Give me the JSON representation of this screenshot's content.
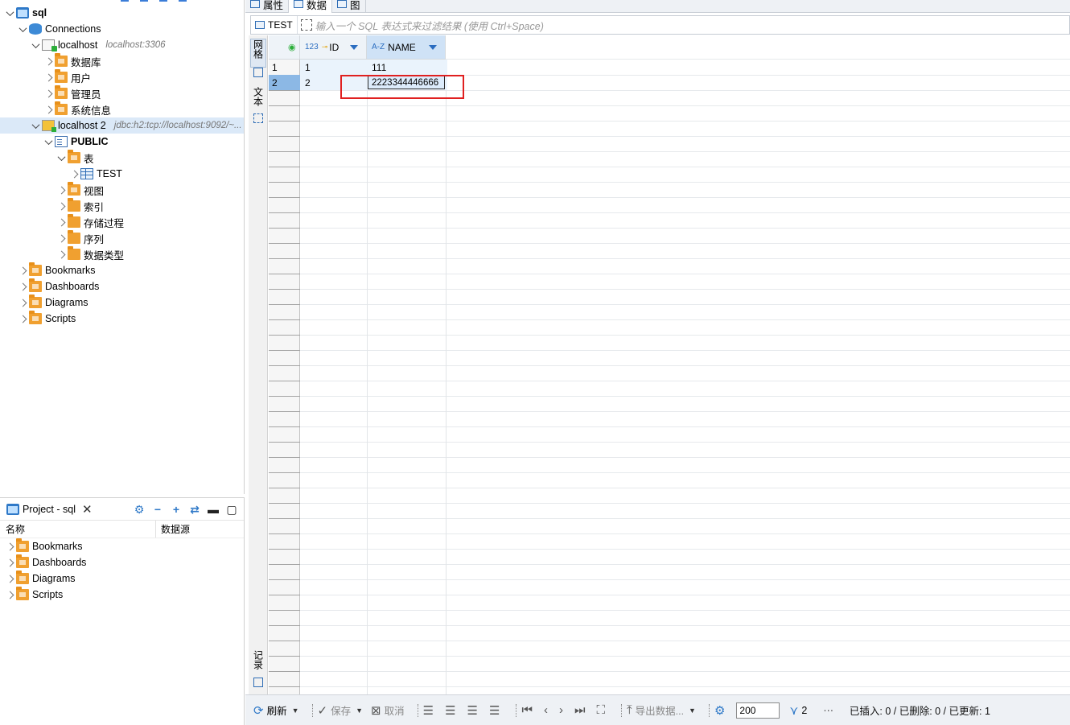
{
  "navigator": {
    "tree": [
      {
        "label": "sql",
        "sub": "",
        "bold": true,
        "depth": 0,
        "chev": "open",
        "icon": "project"
      },
      {
        "label": "Connections",
        "sub": "",
        "depth": 1,
        "chev": "open",
        "icon": "db"
      },
      {
        "label": "localhost",
        "sub": "localhost:3306",
        "depth": 2,
        "chev": "open",
        "icon": "conn"
      },
      {
        "label": "数据库",
        "sub": "",
        "depth": 3,
        "chev": "closed",
        "icon": "folder-sub"
      },
      {
        "label": "用户",
        "sub": "",
        "depth": 3,
        "chev": "closed",
        "icon": "folder-sub"
      },
      {
        "label": "管理员",
        "sub": "",
        "depth": 3,
        "chev": "closed",
        "icon": "folder-sub"
      },
      {
        "label": "系统信息",
        "sub": "",
        "depth": 3,
        "chev": "closed",
        "icon": "folder-sub"
      },
      {
        "label": "localhost 2",
        "sub": "jdbc:h2:tcp://localhost:9092/~...",
        "depth": 2,
        "chev": "open",
        "icon": "h2",
        "selected": true
      },
      {
        "label": "PUBLIC",
        "sub": "",
        "bold": true,
        "depth": 3,
        "chev": "open",
        "icon": "schema"
      },
      {
        "label": "表",
        "sub": "",
        "depth": 4,
        "chev": "open",
        "icon": "folder-sub"
      },
      {
        "label": "TEST",
        "sub": "",
        "depth": 5,
        "chev": "closed",
        "icon": "table"
      },
      {
        "label": "视图",
        "sub": "",
        "depth": 4,
        "chev": "closed",
        "icon": "folder-sub"
      },
      {
        "label": "索引",
        "sub": "",
        "depth": 4,
        "chev": "closed",
        "icon": "folder"
      },
      {
        "label": "存储过程",
        "sub": "",
        "depth": 4,
        "chev": "closed",
        "icon": "folder"
      },
      {
        "label": "序列",
        "sub": "",
        "depth": 4,
        "chev": "closed",
        "icon": "folder"
      },
      {
        "label": "数据类型",
        "sub": "",
        "depth": 4,
        "chev": "closed",
        "icon": "folder"
      },
      {
        "label": "Bookmarks",
        "sub": "",
        "depth": 1,
        "chev": "closed",
        "icon": "folder-sub"
      },
      {
        "label": "Dashboards",
        "sub": "",
        "depth": 1,
        "chev": "closed",
        "icon": "folder-sub"
      },
      {
        "label": "Diagrams",
        "sub": "",
        "depth": 1,
        "chev": "closed",
        "icon": "folder-sub"
      },
      {
        "label": "Scripts",
        "sub": "",
        "depth": 1,
        "chev": "closed",
        "icon": "folder-sub"
      }
    ]
  },
  "project": {
    "title": "Project - sql",
    "columns": [
      "名称",
      "数据源"
    ],
    "items": [
      "Bookmarks",
      "Dashboards",
      "Diagrams",
      "Scripts"
    ]
  },
  "editor": {
    "tabs": [
      "属性",
      "数据",
      "图"
    ],
    "filter": {
      "table": "TEST",
      "placeholder": "输入一个 SQL 表达式来过滤结果 (使用 Ctrl+Space)"
    },
    "side_tabs": [
      "网格",
      "文本",
      "记录"
    ],
    "grid": {
      "columns": [
        {
          "name": "ID",
          "type": "123"
        },
        {
          "name": "NAME",
          "type": "A-Z"
        }
      ],
      "rows": [
        {
          "num": "1",
          "id": "1",
          "name": "111"
        },
        {
          "num": "2",
          "id": "2",
          "name": "2223344446666"
        }
      ]
    },
    "bottom": {
      "refresh": "刷新",
      "save": "保存",
      "cancel": "取消",
      "export": "导出数据...",
      "limit": "200",
      "row_count": "2",
      "status": "已插入: 0 / 已删除: 0 / 已更新: 1"
    }
  },
  "colors": {
    "accent": "#2f79c8",
    "folder": "#f0a030",
    "selection": "#dbe9f8",
    "highlight_box": "#e02020"
  }
}
